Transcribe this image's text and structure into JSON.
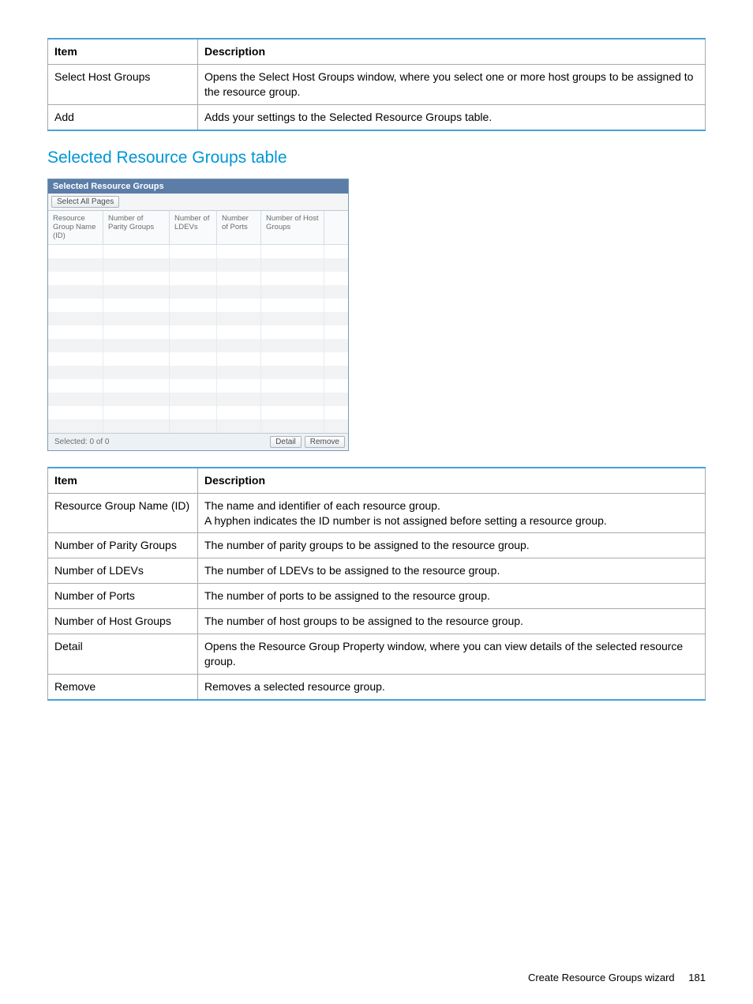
{
  "table1": {
    "headerItem": "Item",
    "headerDesc": "Description",
    "rows": [
      {
        "item": "Select Host Groups",
        "desc": "Opens the Select Host Groups window, where you select one or more host groups to be assigned to the resource group."
      },
      {
        "item": "Add",
        "desc": "Adds your settings to the Selected Resource Groups table."
      }
    ]
  },
  "section_heading": "Selected Resource Groups table",
  "ui": {
    "title": "Selected Resource Groups",
    "selectAll": "Select All Pages",
    "columns": [
      "Resource Group Name (ID)",
      "Number of Parity Groups",
      "Number of LDEVs",
      "Number of Ports",
      "Number of Host Groups"
    ],
    "footerSelected": "Selected:  0    of  0",
    "detail": "Detail",
    "remove": "Remove"
  },
  "chart_data": {
    "type": "table",
    "title": "Selected Resource Groups",
    "columns": [
      "Resource Group Name (ID)",
      "Number of Parity Groups",
      "Number of LDEVs",
      "Number of Ports",
      "Number of Host Groups"
    ],
    "rows": [],
    "selected_count": 0,
    "total_count": 0
  },
  "table2": {
    "headerItem": "Item",
    "headerDesc": "Description",
    "rows": [
      {
        "item": "Resource Group Name (ID)",
        "desc": "The name and identifier of each resource group.\nA hyphen indicates the ID number is not assigned before setting a resource group."
      },
      {
        "item": "Number of Parity Groups",
        "desc": "The number of parity groups to be assigned to the resource group."
      },
      {
        "item": "Number of LDEVs",
        "desc": "The number of LDEVs to be assigned to the resource group."
      },
      {
        "item": "Number of Ports",
        "desc": "The number of ports to be assigned to the resource group."
      },
      {
        "item": "Number of Host Groups",
        "desc": "The number of host groups to be assigned to the resource group."
      },
      {
        "item": "Detail",
        "desc": "Opens the Resource Group Property window, where you can view details of the selected resource group."
      },
      {
        "item": "Remove",
        "desc": "Removes a selected resource group."
      }
    ]
  },
  "footer": {
    "text": "Create Resource Groups wizard",
    "page": "181"
  }
}
